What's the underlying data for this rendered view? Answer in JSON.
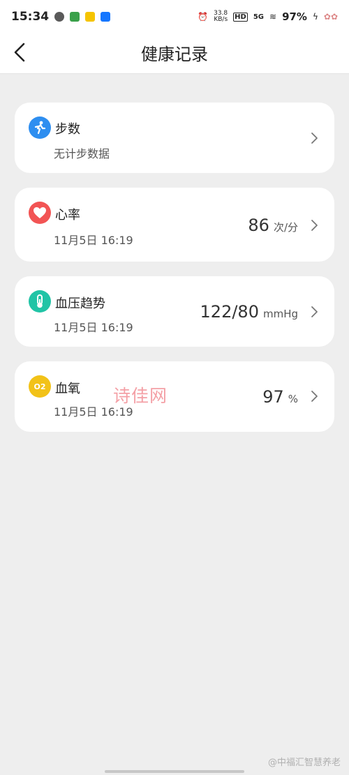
{
  "status_bar": {
    "time": "15:34",
    "net_speed_value": "33.8",
    "net_speed_unit": "KB/s",
    "hd_badge": "HD",
    "network": "5G",
    "battery": "97%"
  },
  "header": {
    "title": "健康记录"
  },
  "cards": [
    {
      "name": "steps",
      "title": "步数",
      "subtitle": "无计步数据",
      "value": "",
      "unit": "",
      "icon": "running-person-icon",
      "color": "#2e8ef0"
    },
    {
      "name": "heart-rate",
      "title": "心率",
      "subtitle": "11月5日 16:19",
      "value": "86",
      "unit": "次/分",
      "icon": "heart-icon",
      "color": "#f25454"
    },
    {
      "name": "blood-pressure",
      "title": "血压趋势",
      "subtitle": "11月5日 16:19",
      "value": "122/80",
      "unit": "mmHg",
      "icon": "thermometer-icon",
      "color": "#21c4a6"
    },
    {
      "name": "blood-oxygen",
      "title": "血氧",
      "subtitle": "11月5日 16:19",
      "value": "97",
      "unit": "%",
      "icon": "o2-icon",
      "color": "#f2c218"
    }
  ],
  "icons": {
    "o2_label": "O2"
  },
  "watermark": "诗佳网",
  "footer_watermark": "@中福汇智慧养老"
}
